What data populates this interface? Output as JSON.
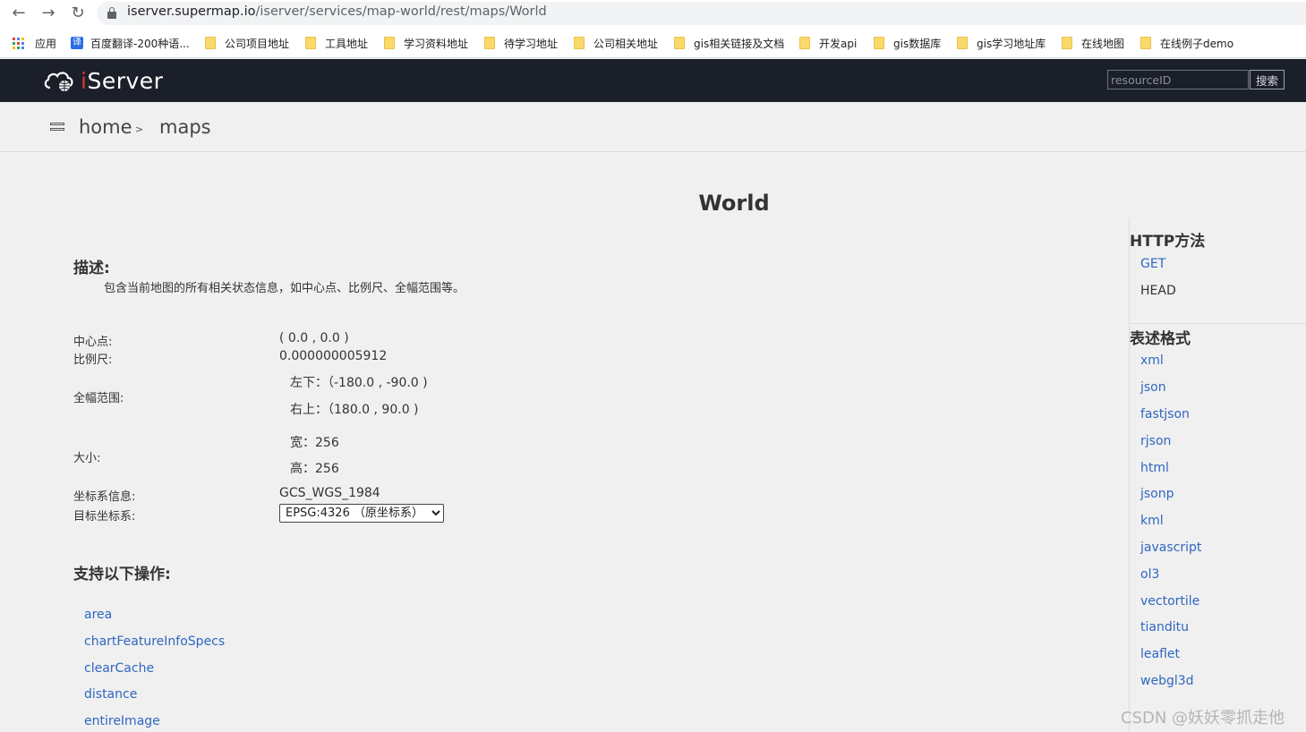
{
  "browser": {
    "url_host": "iserver.supermap.io",
    "url_path": "/iserver/services/map-world/rest/maps/World",
    "bookmarks": [
      {
        "label": "应用",
        "icon": "apps-grid-icon"
      },
      {
        "label": "百度翻译-200种语...",
        "icon": "translate-icon"
      },
      {
        "label": "公司项目地址",
        "icon": "folder-icon"
      },
      {
        "label": "工具地址",
        "icon": "folder-icon"
      },
      {
        "label": "学习资料地址",
        "icon": "folder-icon"
      },
      {
        "label": "待学习地址",
        "icon": "folder-icon"
      },
      {
        "label": "公司相关地址",
        "icon": "folder-icon"
      },
      {
        "label": "gis相关链接及文档",
        "icon": "folder-icon"
      },
      {
        "label": "开发api",
        "icon": "folder-icon"
      },
      {
        "label": "gis数据库",
        "icon": "folder-icon"
      },
      {
        "label": "gis学习地址库",
        "icon": "folder-icon"
      },
      {
        "label": "在线地图",
        "icon": "folder-icon"
      },
      {
        "label": "在线例子demo",
        "icon": "folder-icon"
      }
    ]
  },
  "header": {
    "logo_i": "i",
    "logo_rest": "Server",
    "search_placeholder": "resourceID",
    "search_button": "搜索",
    "colors": {
      "bar": "#1b1f2a",
      "logo_accent": "#e0332f"
    }
  },
  "breadcrumb": {
    "home": "home",
    "sep": ">",
    "current": "maps"
  },
  "main": {
    "title": "World",
    "desc_heading": "描述:",
    "desc_text": "包含当前地图的所有相关状态信息，如中心点、比例尺、全幅范围等。",
    "center_label": "中心点:",
    "center_value": "( 0.0 , 0.0 )",
    "scale_label": "比例尺:",
    "scale_value": "0.000000005912",
    "bounds_label": "全幅范围:",
    "bounds_lower": "左下：（-180.0 , -90.0 )",
    "bounds_upper": "右上：（180.0 , 90.0 )",
    "size_label": "大小:",
    "size_width": "宽：256",
    "size_height": "高：256",
    "crs_label": "坐标系信息:",
    "crs_value": "GCS_WGS_1984",
    "target_crs_label": "目标坐标系:",
    "target_crs_selected": "EPSG:4326 （原坐标系）",
    "ops_heading": "支持以下操作:",
    "operations": [
      "area",
      "chartFeatureInfoSpecs",
      "clearCache",
      "distance",
      "entireImage"
    ]
  },
  "right_panel": {
    "http_heading": "HTTP方法",
    "http_methods": [
      "GET",
      "HEAD"
    ],
    "format_heading": "表述格式",
    "formats": [
      "xml",
      "json",
      "fastjson",
      "rjson",
      "html",
      "jsonp",
      "kml",
      "javascript",
      "ol3",
      "vectortile",
      "tianditu",
      "leaflet",
      "webgl3d"
    ]
  },
  "watermark": "CSDN @妖妖零抓走他"
}
